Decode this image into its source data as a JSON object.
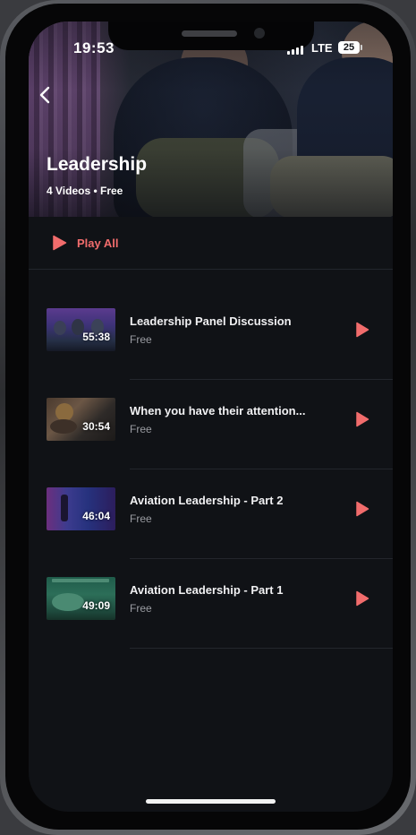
{
  "status_bar": {
    "time": "19:53",
    "network": "LTE",
    "battery": "25"
  },
  "header": {
    "title": "Leadership",
    "subtitle": "4 Videos • Free",
    "back_icon": "chevron-left-icon"
  },
  "play_all": {
    "label": "Play All",
    "icon": "play-icon"
  },
  "videos": [
    {
      "title": "Leadership Panel Discussion",
      "price": "Free",
      "duration": "55:38"
    },
    {
      "title": "When you have their attention...",
      "price": "Free",
      "duration": "30:54"
    },
    {
      "title": "Aviation Leadership - Part 2",
      "price": "Free",
      "duration": "46:04"
    },
    {
      "title": "Aviation Leadership - Part 1",
      "price": "Free",
      "duration": "49:09"
    }
  ],
  "colors": {
    "accent": "#f16c6c",
    "background": "#101216",
    "text_primary": "#f0f0f2",
    "text_secondary": "#9a9ca2",
    "divider": "#23262c"
  }
}
